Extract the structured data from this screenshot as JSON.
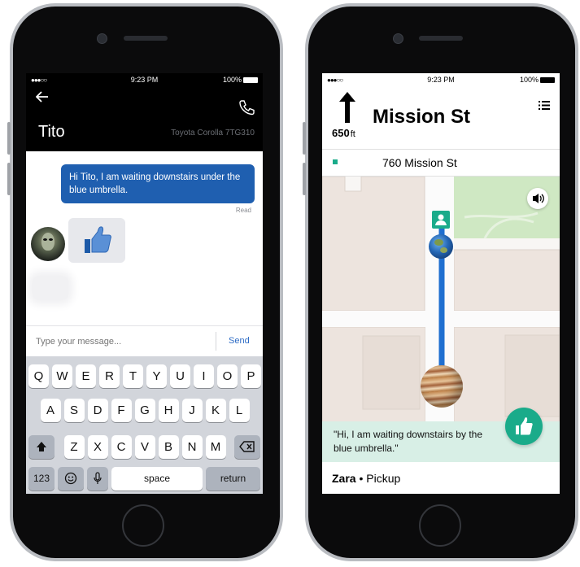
{
  "left_phone": {
    "status": {
      "signal": "●●●○○",
      "time": "9:23 PM",
      "battery": "100%"
    },
    "contact": {
      "name": "Tito",
      "car": "Toyota Corolla 7TG310"
    },
    "messages": {
      "sent_text": "Hi Tito, I am waiting downstairs under the blue umbrella.",
      "read_receipt": "Read"
    },
    "composer": {
      "placeholder": "Type your message...",
      "send_label": "Send"
    },
    "keyboard": {
      "row1": [
        "Q",
        "W",
        "E",
        "R",
        "T",
        "Y",
        "U",
        "I",
        "O",
        "P"
      ],
      "row2": [
        "A",
        "S",
        "D",
        "F",
        "G",
        "H",
        "J",
        "K",
        "L"
      ],
      "row3": [
        "Z",
        "X",
        "C",
        "V",
        "B",
        "N",
        "M"
      ],
      "numbers_label": "123",
      "space_label": "space",
      "return_label": "return"
    }
  },
  "right_phone": {
    "status": {
      "signal": "●●●○○",
      "time": "9:23 PM",
      "battery": "100%"
    },
    "navigation": {
      "distance": "650",
      "unit": "ft",
      "street": "Mission St",
      "address": "760 Mission St"
    },
    "banner": {
      "quote": "\"Hi, I am waiting downstairs by the blue umbrella.\""
    },
    "footer": {
      "rider": "Zara",
      "separator": "•",
      "status": "Pickup"
    }
  },
  "colors": {
    "uber_blue": "#1f5fb0",
    "route_blue": "#1f6fd0",
    "teal_accent": "#1aab8a",
    "banner_bg": "#d8efe6",
    "map_block": "#ede4de",
    "map_park": "#cfe8c3"
  },
  "icons": [
    "back-arrow-icon",
    "phone-icon",
    "thumbs-up-icon",
    "shift-icon",
    "backspace-icon",
    "emoji-icon",
    "microphone-icon",
    "turn-arrow-icon",
    "menu-icon",
    "speaker-icon",
    "person-icon"
  ]
}
